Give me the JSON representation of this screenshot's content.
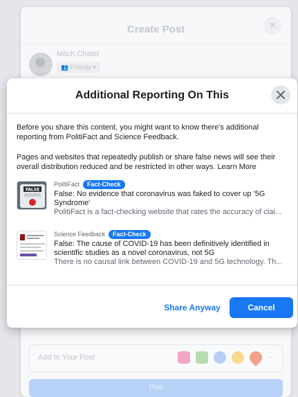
{
  "background": {
    "title": "Create Post",
    "close_icon": "×",
    "user_name": "Mitch Chalet",
    "audience": "👥 Friends ▾",
    "add_to_post": "Add to Your Post",
    "more_icon": "···",
    "post_button": "Post",
    "icon_colors": [
      "#f3a6c6",
      "#b7dbb1",
      "#b7cff5",
      "#f7db8f",
      "#f5a08a"
    ]
  },
  "modal": {
    "title": "Additional Reporting On This",
    "close_icon": "close-icon",
    "intro": "Before you share this content, you might want to know there's additional reporting from PolitiFact and Science Feedback.",
    "policy": "Pages and websites that repeatedly publish or share false news will see their overall distribution reduced and be restricted in other ways.",
    "learn_more": "Learn More",
    "items": [
      {
        "source": "PolitiFact",
        "badge": "Fact-Check",
        "claim": "False: No evidence that coronavirus was faked to cover up '5G Syndrome'",
        "explanation": "PolitiFact is a fact-checking website that rates the accuracy of clai..."
      },
      {
        "source": "Science Feedback",
        "badge": "Fact-Check",
        "claim": "False: The cause of COVID-19 has been definitively identified in scientific studies as a novel coronavirus, not 5G",
        "explanation": "There is no causal link between COVID-19 and 5G technology. Th..."
      }
    ],
    "share_anyway": "Share Anyway",
    "cancel": "Cancel"
  },
  "thumb_politifact": {
    "label": "FALSE"
  },
  "colors": {
    "accent": "#1877f2",
    "badge": "#1877f2"
  }
}
